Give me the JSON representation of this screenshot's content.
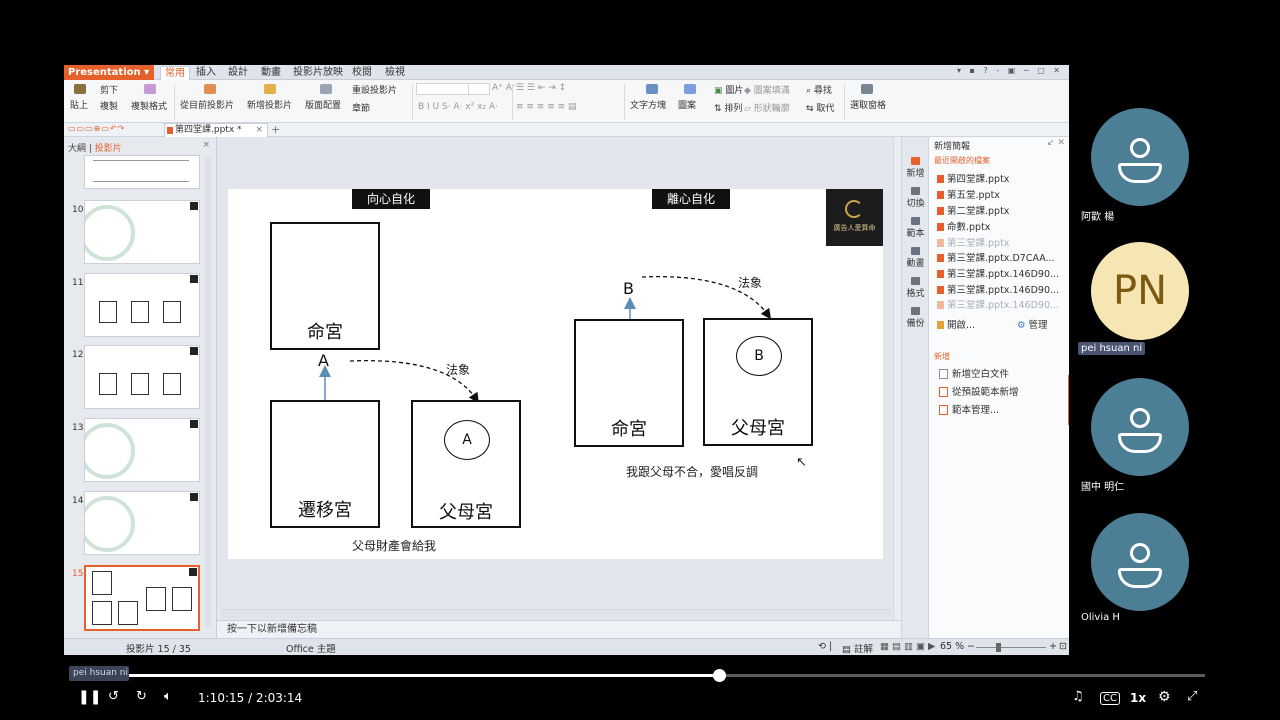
{
  "app": {
    "name": "Presentation",
    "menu_tabs": [
      "常用",
      "插入",
      "設計",
      "動畫",
      "投影片放映",
      "校閱",
      "檢視"
    ],
    "active_tab": "常用"
  },
  "ribbon": {
    "paste": "貼上",
    "cut": "剪下",
    "copy": "複製",
    "format_painter": "複製格式",
    "from_current": "從目前投影片",
    "new_slide": "新增投影片",
    "layout": "版面配置",
    "reset_slide": "重設投影片",
    "section": "章節",
    "text_box": "文字方塊",
    "shapes": "圖案",
    "picture": "圖片",
    "arrange": "排列",
    "shape_fill": "圖案填滿",
    "shape_outline": "形狀輪廓",
    "find": "尋找",
    "replace": "取代",
    "selection_pane": "選取窗格"
  },
  "document_tab": {
    "name": "第四堂課.pptx *"
  },
  "left_panel": {
    "tab_outline": "大綱",
    "tab_slides": "投影片",
    "thumb_numbers": [
      "10",
      "11",
      "12",
      "13",
      "14",
      "15"
    ],
    "selected": "15"
  },
  "slide": {
    "left_title": "向心自化",
    "right_title": "離心自化",
    "left_diagram": {
      "box_top": "命宮",
      "box_bottom_left": "遷移宮",
      "box_bottom_right": "父母宮",
      "letter": "A",
      "circle_letter": "A",
      "arrow_label": "法象",
      "caption": "父母財產會給我"
    },
    "right_diagram": {
      "box_left": "命宮",
      "box_right": "父母宮",
      "letter": "B",
      "circle_letter": "B",
      "arrow_label": "法象",
      "caption": "我跟父母不合，愛唱反調"
    },
    "logo_text": "廣告人愛算命"
  },
  "notes_placeholder": "按一下以新增備忘稿",
  "side_strip": [
    "新增",
    "切換",
    "範本",
    "動畫",
    "格式",
    "備份"
  ],
  "task_pane": {
    "title": "新增簡報",
    "recent_label": "最近開啟的檔案",
    "recent_files": [
      {
        "name": "第四堂課.pptx",
        "dim": false
      },
      {
        "name": "第五堂.pptx",
        "dim": false
      },
      {
        "name": "第二堂課.pptx",
        "dim": false
      },
      {
        "name": "命數.pptx",
        "dim": false
      },
      {
        "name": "第三堂課.pptx",
        "dim": true
      },
      {
        "name": "第三堂課.pptx.D7CAA...",
        "dim": false
      },
      {
        "name": "第三堂課.pptx.146D90...",
        "dim": false
      },
      {
        "name": "第三堂課.pptx.146D90...",
        "dim": false
      },
      {
        "name": "第三堂課.pptx.146D90...",
        "dim": true
      }
    ],
    "open_label": "開啟...",
    "manage_label": "管理",
    "new_label": "新增",
    "new_items": [
      "新增空白文件",
      "從預設範本新增",
      "範本管理..."
    ]
  },
  "statusbar": {
    "slide_info": "投影片 15 / 35",
    "theme": "Office 主題",
    "notes_btn": "註解",
    "zoom": "65 %"
  },
  "participants": [
    {
      "name": "阿歡 楊",
      "initials": ""
    },
    {
      "name": "pei hsuan ni",
      "initials": "PN"
    },
    {
      "name": "國中 明仁",
      "initials": ""
    },
    {
      "name": "Olivia H",
      "initials": ""
    }
  ],
  "player": {
    "current_time": "1:10:15",
    "duration": "2:03:14",
    "time_display": "1:10:15 / 2:03:14",
    "progress": 0.57,
    "speed": "1x",
    "rewind_icon": "rewind-10-icon",
    "forward_icon": "forward-10-icon",
    "bubble_label": "pei hsuan ni"
  }
}
